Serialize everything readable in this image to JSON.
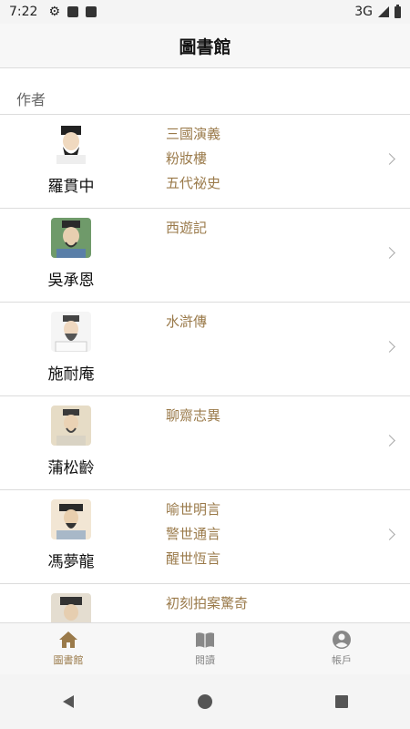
{
  "status_bar": {
    "time": "7:22",
    "network": "3G",
    "icons": [
      "gear-icon",
      "a-icon",
      "sd-card-icon",
      "signal-icon",
      "battery-icon"
    ]
  },
  "header": {
    "title": "圖書館"
  },
  "section": {
    "label": "作者"
  },
  "authors": [
    {
      "name": "羅貫中",
      "books": [
        "三國演義",
        "粉妝樓",
        "五代祕史"
      ]
    },
    {
      "name": "吳承恩",
      "books": [
        "西遊記"
      ]
    },
    {
      "name": "施耐庵",
      "books": [
        "水滸傳"
      ]
    },
    {
      "name": "蒲松齡",
      "books": [
        "聊齋志異"
      ]
    },
    {
      "name": "馮夢龍",
      "books": [
        "喻世明言",
        "警世通言",
        "醒世恆言"
      ]
    },
    {
      "name": "",
      "books": [
        "初刻拍案驚奇"
      ]
    }
  ],
  "bottom_nav": {
    "tabs": [
      {
        "label": "圖書館",
        "icon": "home-icon",
        "active": true
      },
      {
        "label": "閱讀",
        "icon": "book-icon",
        "active": false
      },
      {
        "label": "帳戶",
        "icon": "account-icon",
        "active": false
      }
    ]
  },
  "colors": {
    "accent": "#9a7a4a",
    "divider": "#dcdcdc",
    "inactive": "#888888"
  }
}
